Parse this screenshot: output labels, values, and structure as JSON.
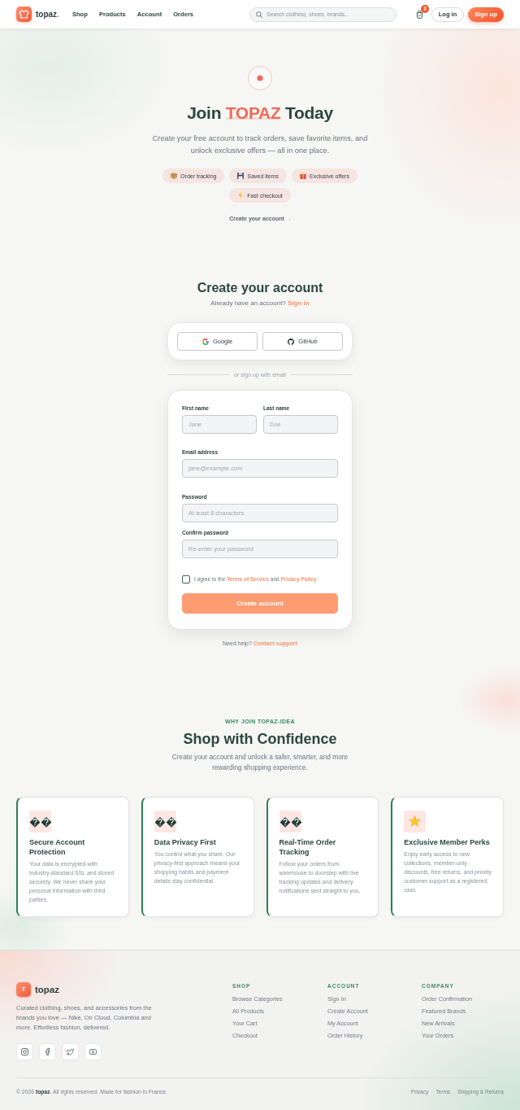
{
  "header": {
    "brand": {
      "name": "topaz",
      "dot": "."
    },
    "nav": [
      {
        "label": "Shop"
      },
      {
        "label": "Products"
      },
      {
        "label": "Account"
      },
      {
        "label": "Orders"
      }
    ],
    "search": {
      "placeholder": "Search clothing, shoes, brands..."
    },
    "cart": {
      "count": "3"
    },
    "login": "Log in",
    "signup": "Sign up"
  },
  "hero": {
    "title": {
      "before": "Join",
      "highlight": "TOPAZ",
      "after": "Today"
    },
    "subtitle": "Create your free account to track orders, save favorite items, and unlock exclusive offers — all in one place.",
    "chips": [
      {
        "label": "Order tracking"
      },
      {
        "label": "Saved items"
      },
      {
        "label": "Exclusive offers"
      },
      {
        "label": "Fast checkout"
      }
    ],
    "scroll_link": {
      "label": "Create your account",
      "arrow": "↓"
    }
  },
  "signup": {
    "title": "Create your account",
    "prompt": "Already have an account?",
    "signin_link": "Sign in",
    "social": [
      {
        "label": "Google"
      },
      {
        "label": "GitHub"
      }
    ],
    "divider": "or sign up with email",
    "fields": [
      {
        "label": "First name",
        "placeholder": "Jane"
      },
      {
        "label": "Last name",
        "placeholder": "Doe"
      },
      {
        "label": "Email address",
        "placeholder": "jane@example.com"
      },
      {
        "label": "Password",
        "placeholder": "At least 8 characters"
      },
      {
        "label": "Confirm password",
        "placeholder": "Re-enter your password"
      }
    ],
    "agree": {
      "checked": false,
      "before": "I agree to the",
      "terms_link": "Terms of Service",
      "middle": "and",
      "privacy_link": "Privacy Policy"
    },
    "submit": "Create account",
    "help": {
      "prompt": "Need help?",
      "link": "Contact support"
    }
  },
  "benefits": {
    "eyebrow": "WHY JOIN TOPAZ-IDEA",
    "title": "Shop with Confidence",
    "subtitle": "Create your account and unlock a safer, smarter, and more rewarding shopping experience.",
    "cards": [
      {
        "kind": "glyph",
        "title": "Secure Account Protection",
        "text": "Your data is encrypted with industry-standard SSL and stored securely. We never share your personal information with third parties."
      },
      {
        "kind": "glyph",
        "title": "Data Privacy First",
        "text": "You control what you share. Our privacy-first approach means your shopping habits and payment details stay confidential."
      },
      {
        "kind": "glyph",
        "title": "Real-Time Order Tracking",
        "text": "Follow your orders from warehouse to doorstep with live tracking updates and delivery notifications sent straight to you."
      },
      {
        "kind": "star",
        "title": "Exclusive Member Perks",
        "text": "Enjoy early access to new collections, member-only discounts, free returns, and priority customer support as a registered user."
      }
    ]
  },
  "footer": {
    "logo_letter": "T",
    "brand": "topaz",
    "description": "Curated clothing, shoes, and accessories from the brands you love — Nike, On Cloud, Columbia and more. Effortless fashion, delivered.",
    "columns": [
      {
        "heading": "SHOP",
        "links": [
          "Browse Categories",
          "All Products",
          "Your Cart",
          "Checkout"
        ]
      },
      {
        "heading": "ACCOUNT",
        "links": [
          "Sign In",
          "Create Account",
          "My Account",
          "Order History"
        ]
      },
      {
        "heading": "COMPANY",
        "links": [
          "Order Confirmation",
          "Featured Brands",
          "New Arrivals",
          "Your Orders"
        ]
      }
    ],
    "copyright": "© 2026 **topaz**. All rights reserved. Made for fashion in France.",
    "legal": [
      "Privacy",
      "Terms",
      "Shipping & Returns"
    ]
  }
}
